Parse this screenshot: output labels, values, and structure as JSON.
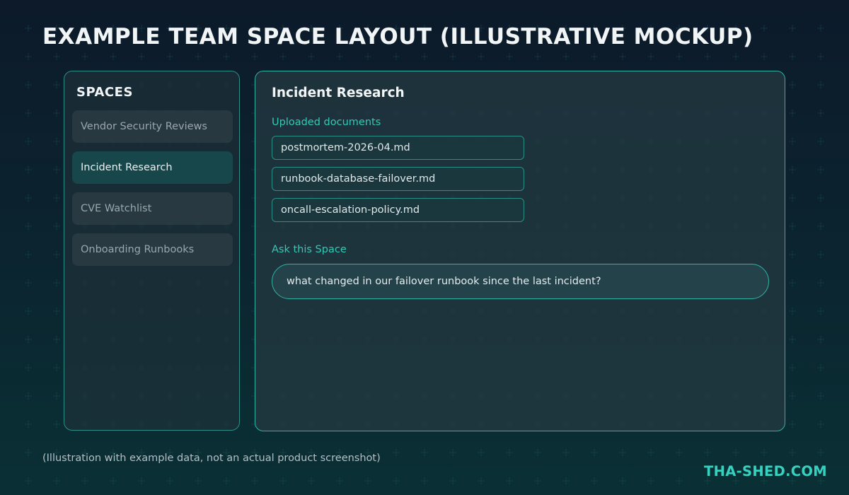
{
  "page_title": "EXAMPLE TEAM SPACE LAYOUT (ILLUSTRATIVE MOCKUP)",
  "sidebar": {
    "heading": "SPACES",
    "items": [
      {
        "label": "Vendor Security Reviews",
        "active": false
      },
      {
        "label": "Incident Research",
        "active": true
      },
      {
        "label": "CVE Watchlist",
        "active": false
      },
      {
        "label": "Onboarding Runbooks",
        "active": false
      }
    ]
  },
  "main": {
    "title": "Incident Research",
    "documents_label": "Uploaded documents",
    "documents": [
      "postmortem-2026-04.md",
      "runbook-database-failover.md",
      "oncall-escalation-policy.md"
    ],
    "ask_label": "Ask this Space",
    "ask_value": "what changed in our failover runbook since the last incident?"
  },
  "footer": {
    "caption": "(Illustration with example data, not an actual product screenshot)",
    "brand": "THA-SHED.COM"
  },
  "colors": {
    "accent": "#2fb3a4",
    "brand": "#36d1bf",
    "active_item": "#17474b"
  }
}
